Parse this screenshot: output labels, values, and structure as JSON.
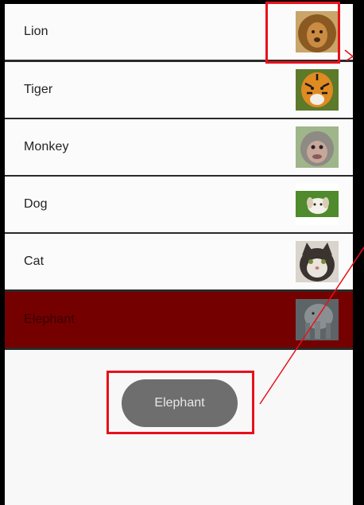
{
  "list": {
    "items": [
      {
        "label": "Lion",
        "image": "lion-photo",
        "selected": false
      },
      {
        "label": "Tiger",
        "image": "tiger-photo",
        "selected": false
      },
      {
        "label": "Monkey",
        "image": "monkey-photo",
        "selected": false
      },
      {
        "label": "Dog",
        "image": "dog-photo",
        "selected": false
      },
      {
        "label": "Cat",
        "image": "cat-photo",
        "selected": false
      },
      {
        "label": "Elephant",
        "image": "elephant-photo",
        "selected": true
      }
    ]
  },
  "toast": {
    "text": "Elephant"
  },
  "colors": {
    "selected_row": "#740000",
    "toast_bg": "#6e6e6e",
    "annotation": "#e8101a"
  }
}
